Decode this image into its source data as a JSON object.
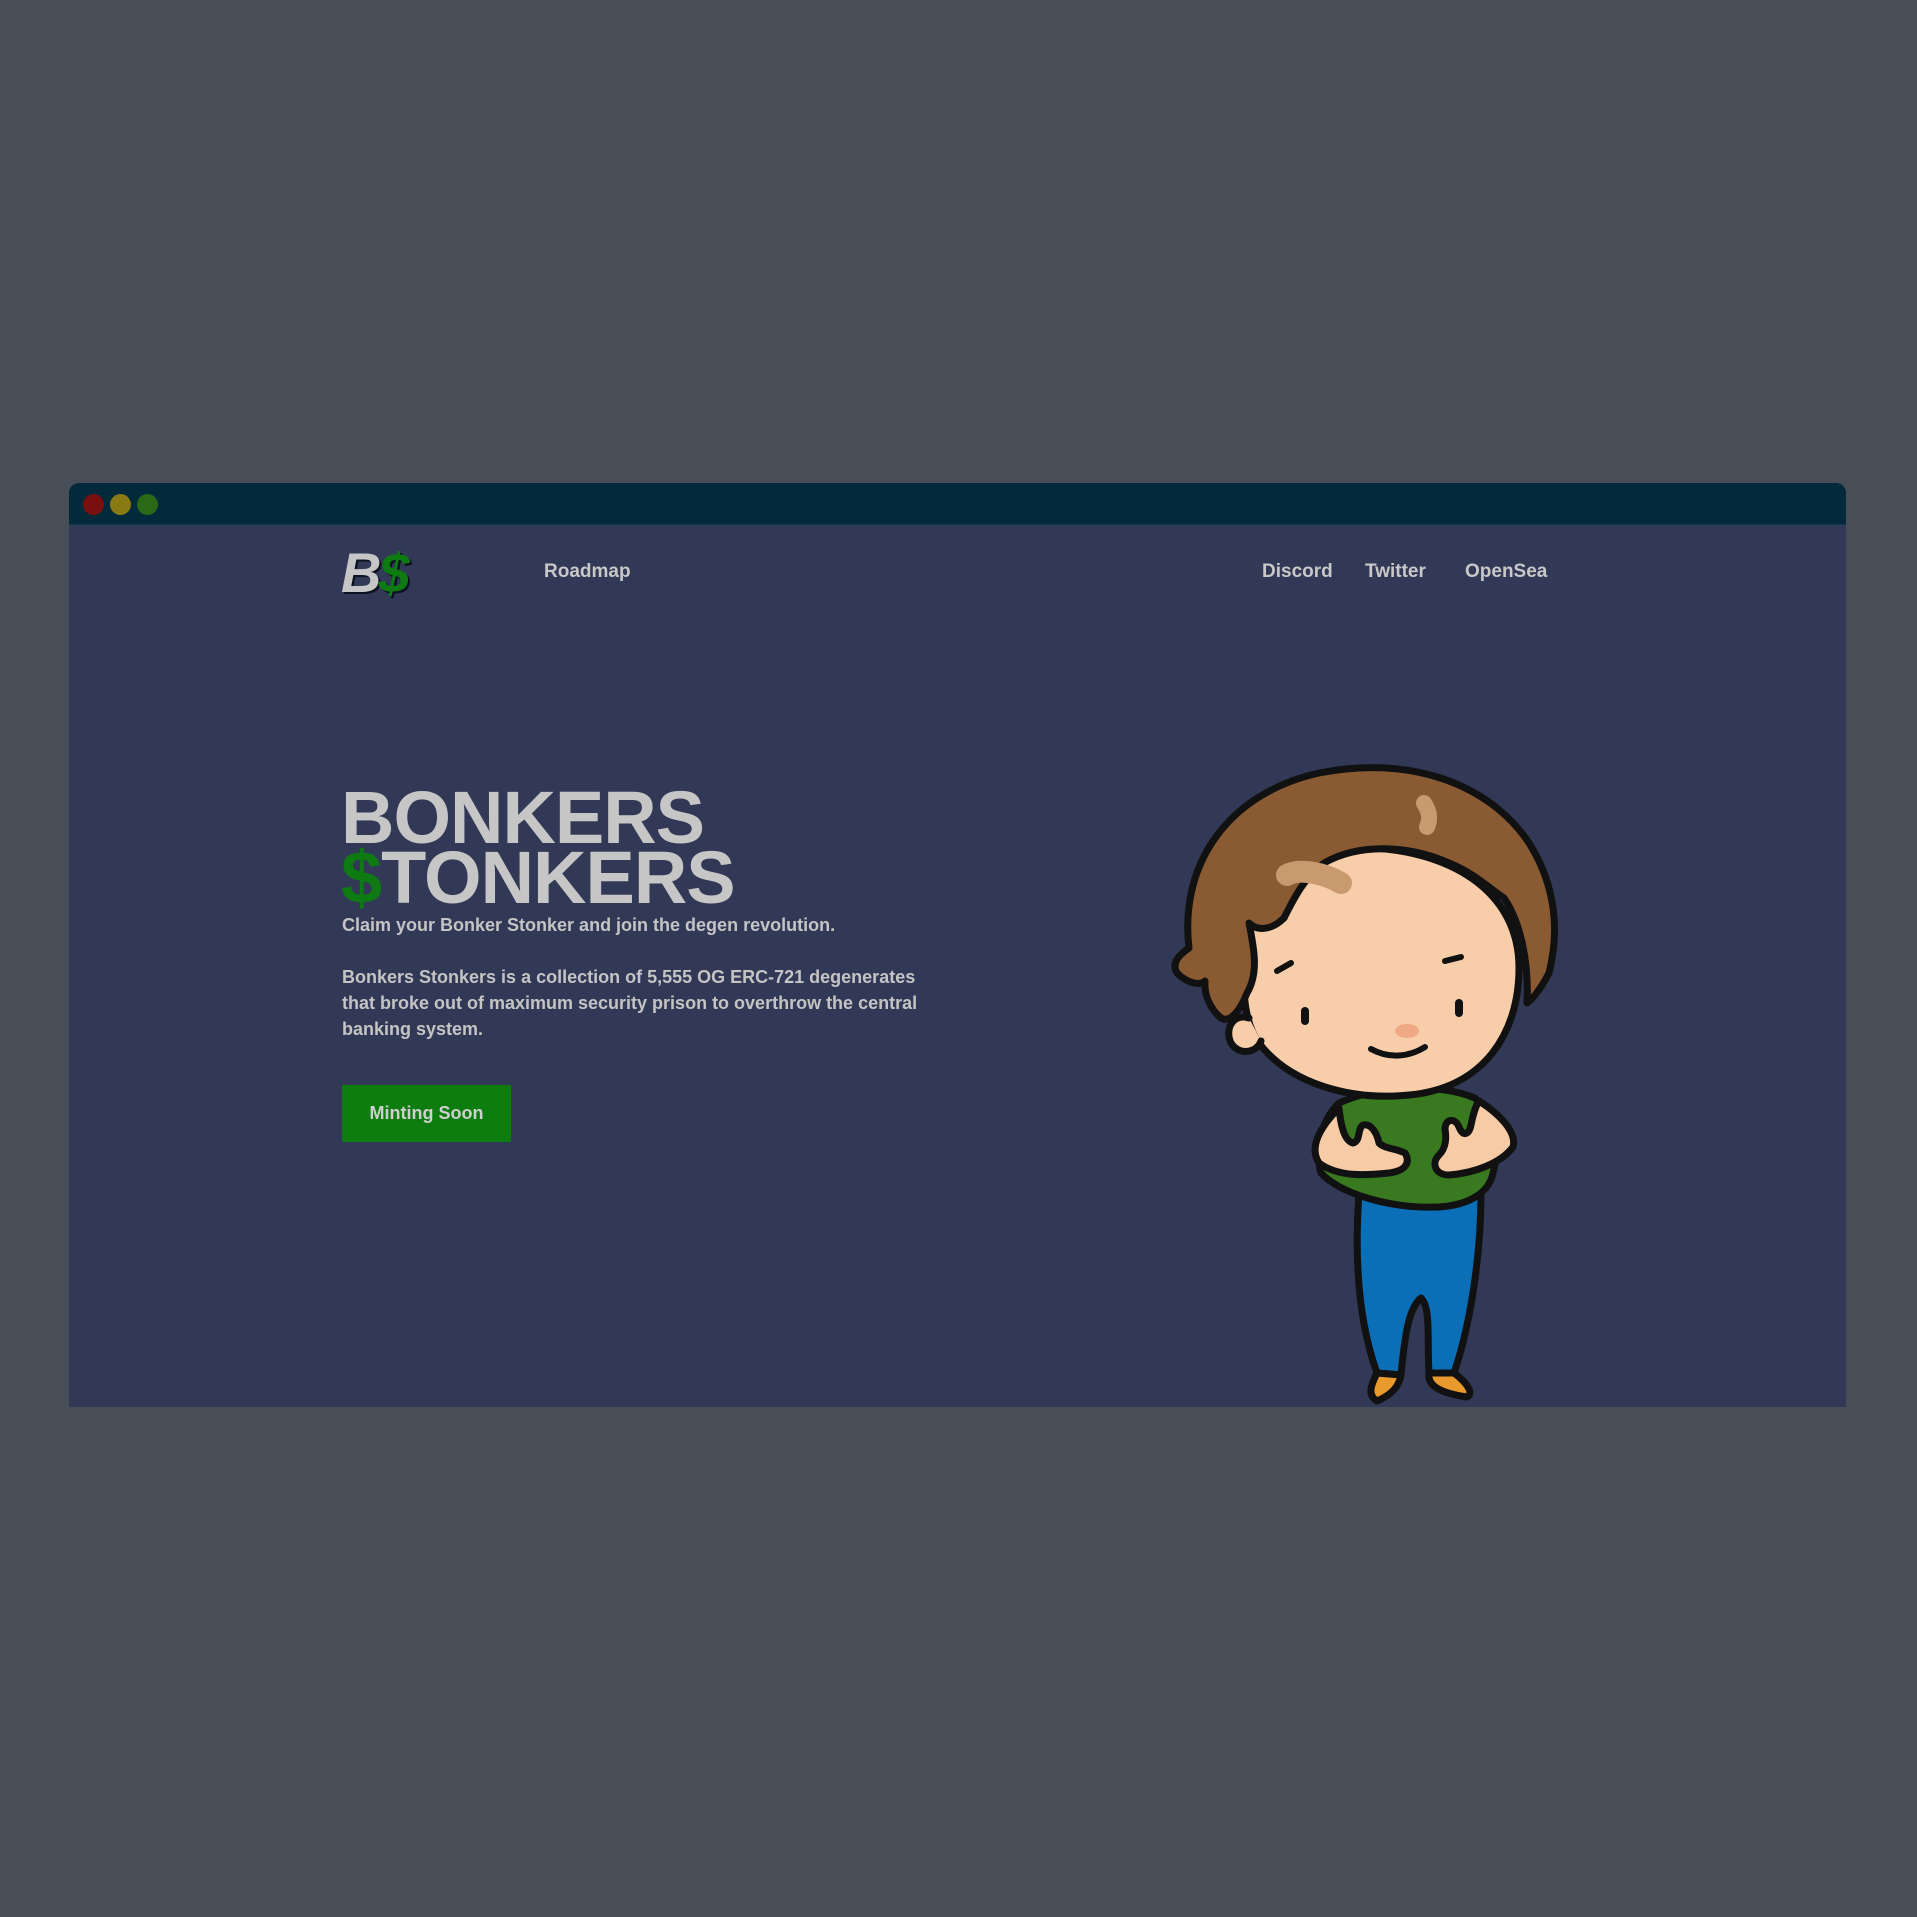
{
  "window": {
    "controls": [
      {
        "name": "close",
        "color": "#7a0f0f"
      },
      {
        "name": "minimize",
        "color": "#8a7a14"
      },
      {
        "name": "maximize",
        "color": "#2a6a16"
      }
    ]
  },
  "header": {
    "logo": {
      "letter": "B",
      "symbol": "$"
    },
    "nav_left": [
      "Roadmap"
    ],
    "nav_right": [
      "Discord",
      "Twitter",
      "OpenSea"
    ]
  },
  "hero": {
    "title_line1": "BONKERS",
    "title_line2_symbol": "$",
    "title_line2_rest": "TONKERS",
    "subtitle": "Claim your Bonker Stonker and join the degen revolution.",
    "description": "Bonkers Stonkers is a collection of 5,555 OG ERC-721 degenerates that broke out of maximum security prison to overthrow the central banking system.",
    "cta_label": "Minting Soon"
  },
  "colors": {
    "page_background": "#474e57",
    "site_background": "#323956",
    "titlebar": "#022a3b",
    "accent_green": "#0d7d10",
    "text": "#c6c6c6"
  },
  "illustration": {
    "subject": "cartoon-character"
  }
}
